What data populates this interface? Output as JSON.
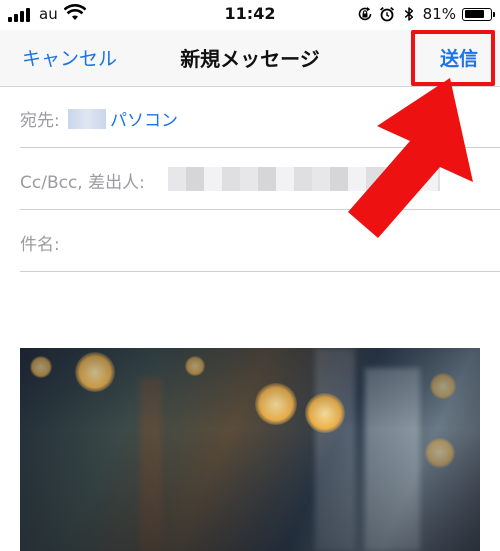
{
  "status_bar": {
    "carrier": "au",
    "time": "11:42",
    "battery_percent": "81%",
    "battery_level": 0.81,
    "icons": [
      "signal-icon",
      "wifi-icon",
      "rotation-lock-icon",
      "alarm-icon",
      "bluetooth-icon",
      "battery-icon"
    ]
  },
  "nav": {
    "cancel_label": "キャンセル",
    "title": "新規メッセージ",
    "send_label": "送信"
  },
  "fields": {
    "to_label": "宛先:",
    "to_value": "パソコン",
    "cc_label": "Cc/Bcc, 差出人:",
    "subject_label": "件名:"
  },
  "colors": {
    "accent": "#1a73e8",
    "highlight": "#ee1111"
  }
}
